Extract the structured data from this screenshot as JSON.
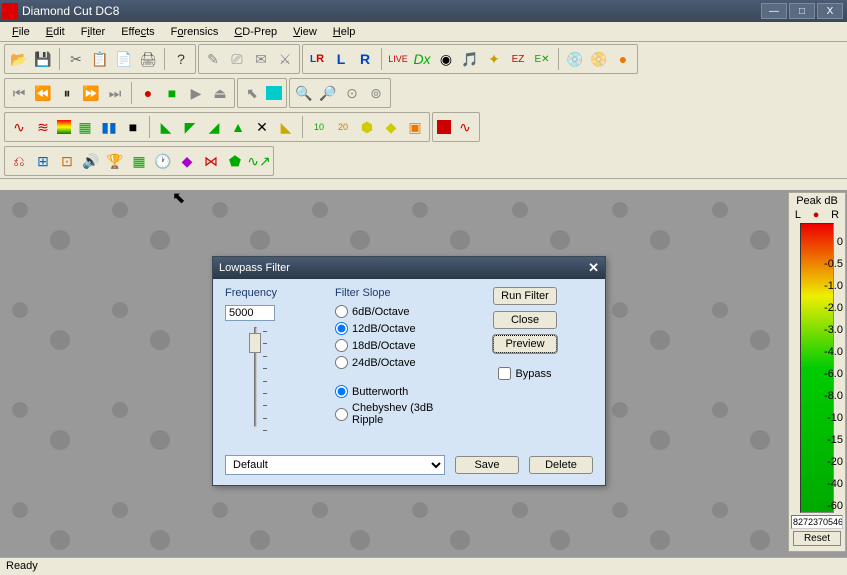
{
  "window": {
    "title": "Diamond Cut DC8",
    "minimize": "—",
    "maximize": "□",
    "close": "X"
  },
  "menu": {
    "items": [
      {
        "label": "File",
        "u": "F"
      },
      {
        "label": "Edit",
        "u": "E"
      },
      {
        "label": "Filter",
        "u": "i"
      },
      {
        "label": "Effects",
        "u": "c"
      },
      {
        "label": "Forensics",
        "u": "o"
      },
      {
        "label": "CD-Prep",
        "u": "C"
      },
      {
        "label": "View",
        "u": "V"
      },
      {
        "label": "Help",
        "u": "H"
      }
    ]
  },
  "meter": {
    "title": "Peak dB",
    "left": "L",
    "right": "R",
    "scale": [
      "0",
      "-0.5",
      "-1.0",
      "-2.0",
      "-3.0",
      "-4.0",
      "-6.0",
      "-8.0",
      "-10",
      "-15",
      "-20",
      "-40",
      "-60"
    ],
    "readout": "8272370546",
    "reset": "Reset"
  },
  "dialog": {
    "title": "Lowpass Filter",
    "freq_label": "Frequency",
    "freq_value": "5000",
    "slope_label": "Filter Slope",
    "slopes": [
      "6dB/Octave",
      "12dB/Octave",
      "18dB/Octave",
      "24dB/Octave"
    ],
    "types": [
      "Butterworth",
      "Chebyshev (3dB Ripple"
    ],
    "run": "Run Filter",
    "close": "Close",
    "preview": "Preview",
    "bypass": "Bypass",
    "preset": "Default",
    "save": "Save",
    "delete": "Delete"
  },
  "status": {
    "ready": "Ready"
  }
}
